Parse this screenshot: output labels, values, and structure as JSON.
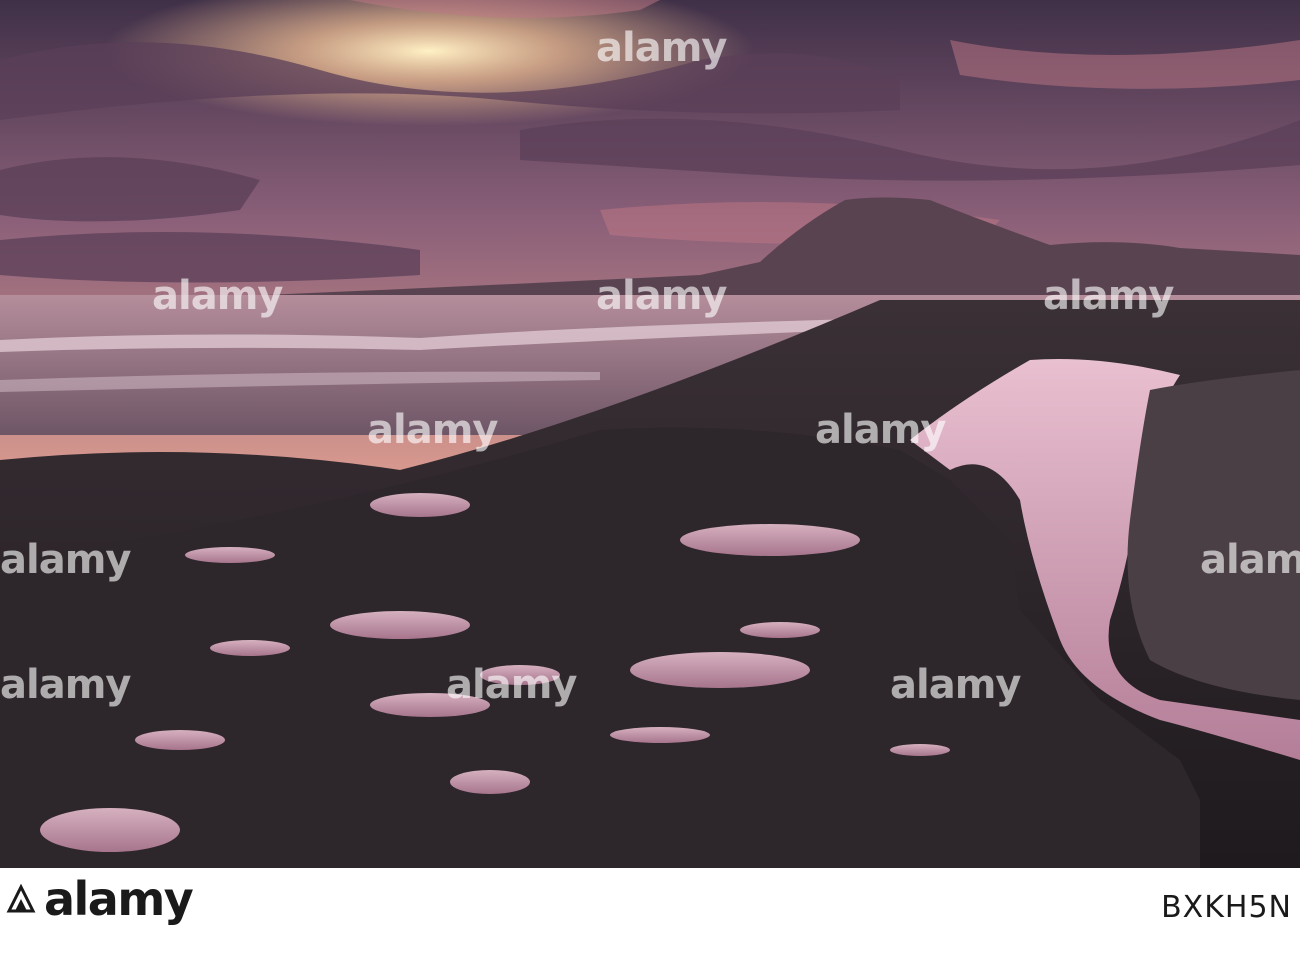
{
  "photo": {
    "scene": "sunset coastline",
    "colors": {
      "sky_top": "#4a3550",
      "sky_mid": "#c88a90",
      "glow": "#ffe6b8",
      "sea": "#9b8093",
      "rock": "#2b2428",
      "pool": "#d7a6ba"
    }
  },
  "watermarks": [
    "alamy",
    "alamy",
    "alamy",
    "alamy",
    "alamy",
    "alamy",
    "alamy",
    "alamy",
    "alamy",
    "alamy",
    "alamy"
  ],
  "footer": {
    "logo_text": "alamy",
    "logo_icon": "alamy-logo-icon",
    "image_id": "BXKH5N"
  }
}
